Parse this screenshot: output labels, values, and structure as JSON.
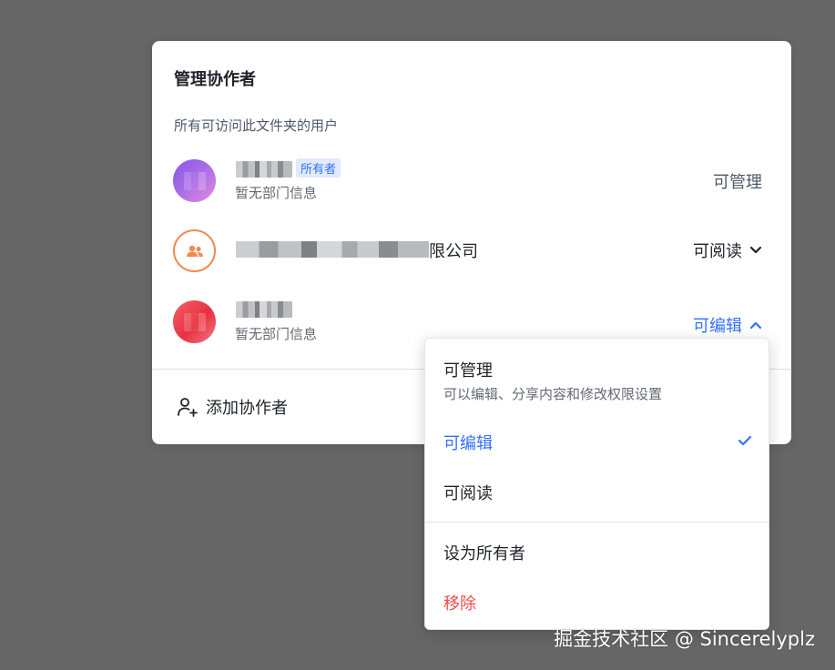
{
  "panel": {
    "title": "管理协作者",
    "subtitle": "所有可访问此文件夹的用户"
  },
  "members": [
    {
      "name_suffix": "",
      "badge": "所有者",
      "dept": "暂无部门信息",
      "permission": "可管理",
      "avatar_color": "#9a60e6"
    },
    {
      "name_suffix": "限公司",
      "permission": "可阅读",
      "avatar_color": "#f08a4b"
    },
    {
      "name_suffix": "",
      "dept": "暂无部门信息",
      "permission": "可编辑",
      "avatar_color": "#ec3b49"
    }
  ],
  "add_collaborator": "添加协作者",
  "dropdown": {
    "items": [
      {
        "label": "可管理",
        "desc": "可以编辑、分享内容和修改权限设置"
      },
      {
        "label": "可编辑",
        "selected": true
      },
      {
        "label": "可阅读"
      },
      {
        "label": "设为所有者"
      },
      {
        "label": "移除",
        "color": "#f54a45"
      }
    ]
  },
  "watermark": "掘金技术社区 @ Sincerelyplz",
  "colors": {
    "accent": "#3370ff",
    "danger": "#f54a45",
    "backdrop": "#666666"
  }
}
